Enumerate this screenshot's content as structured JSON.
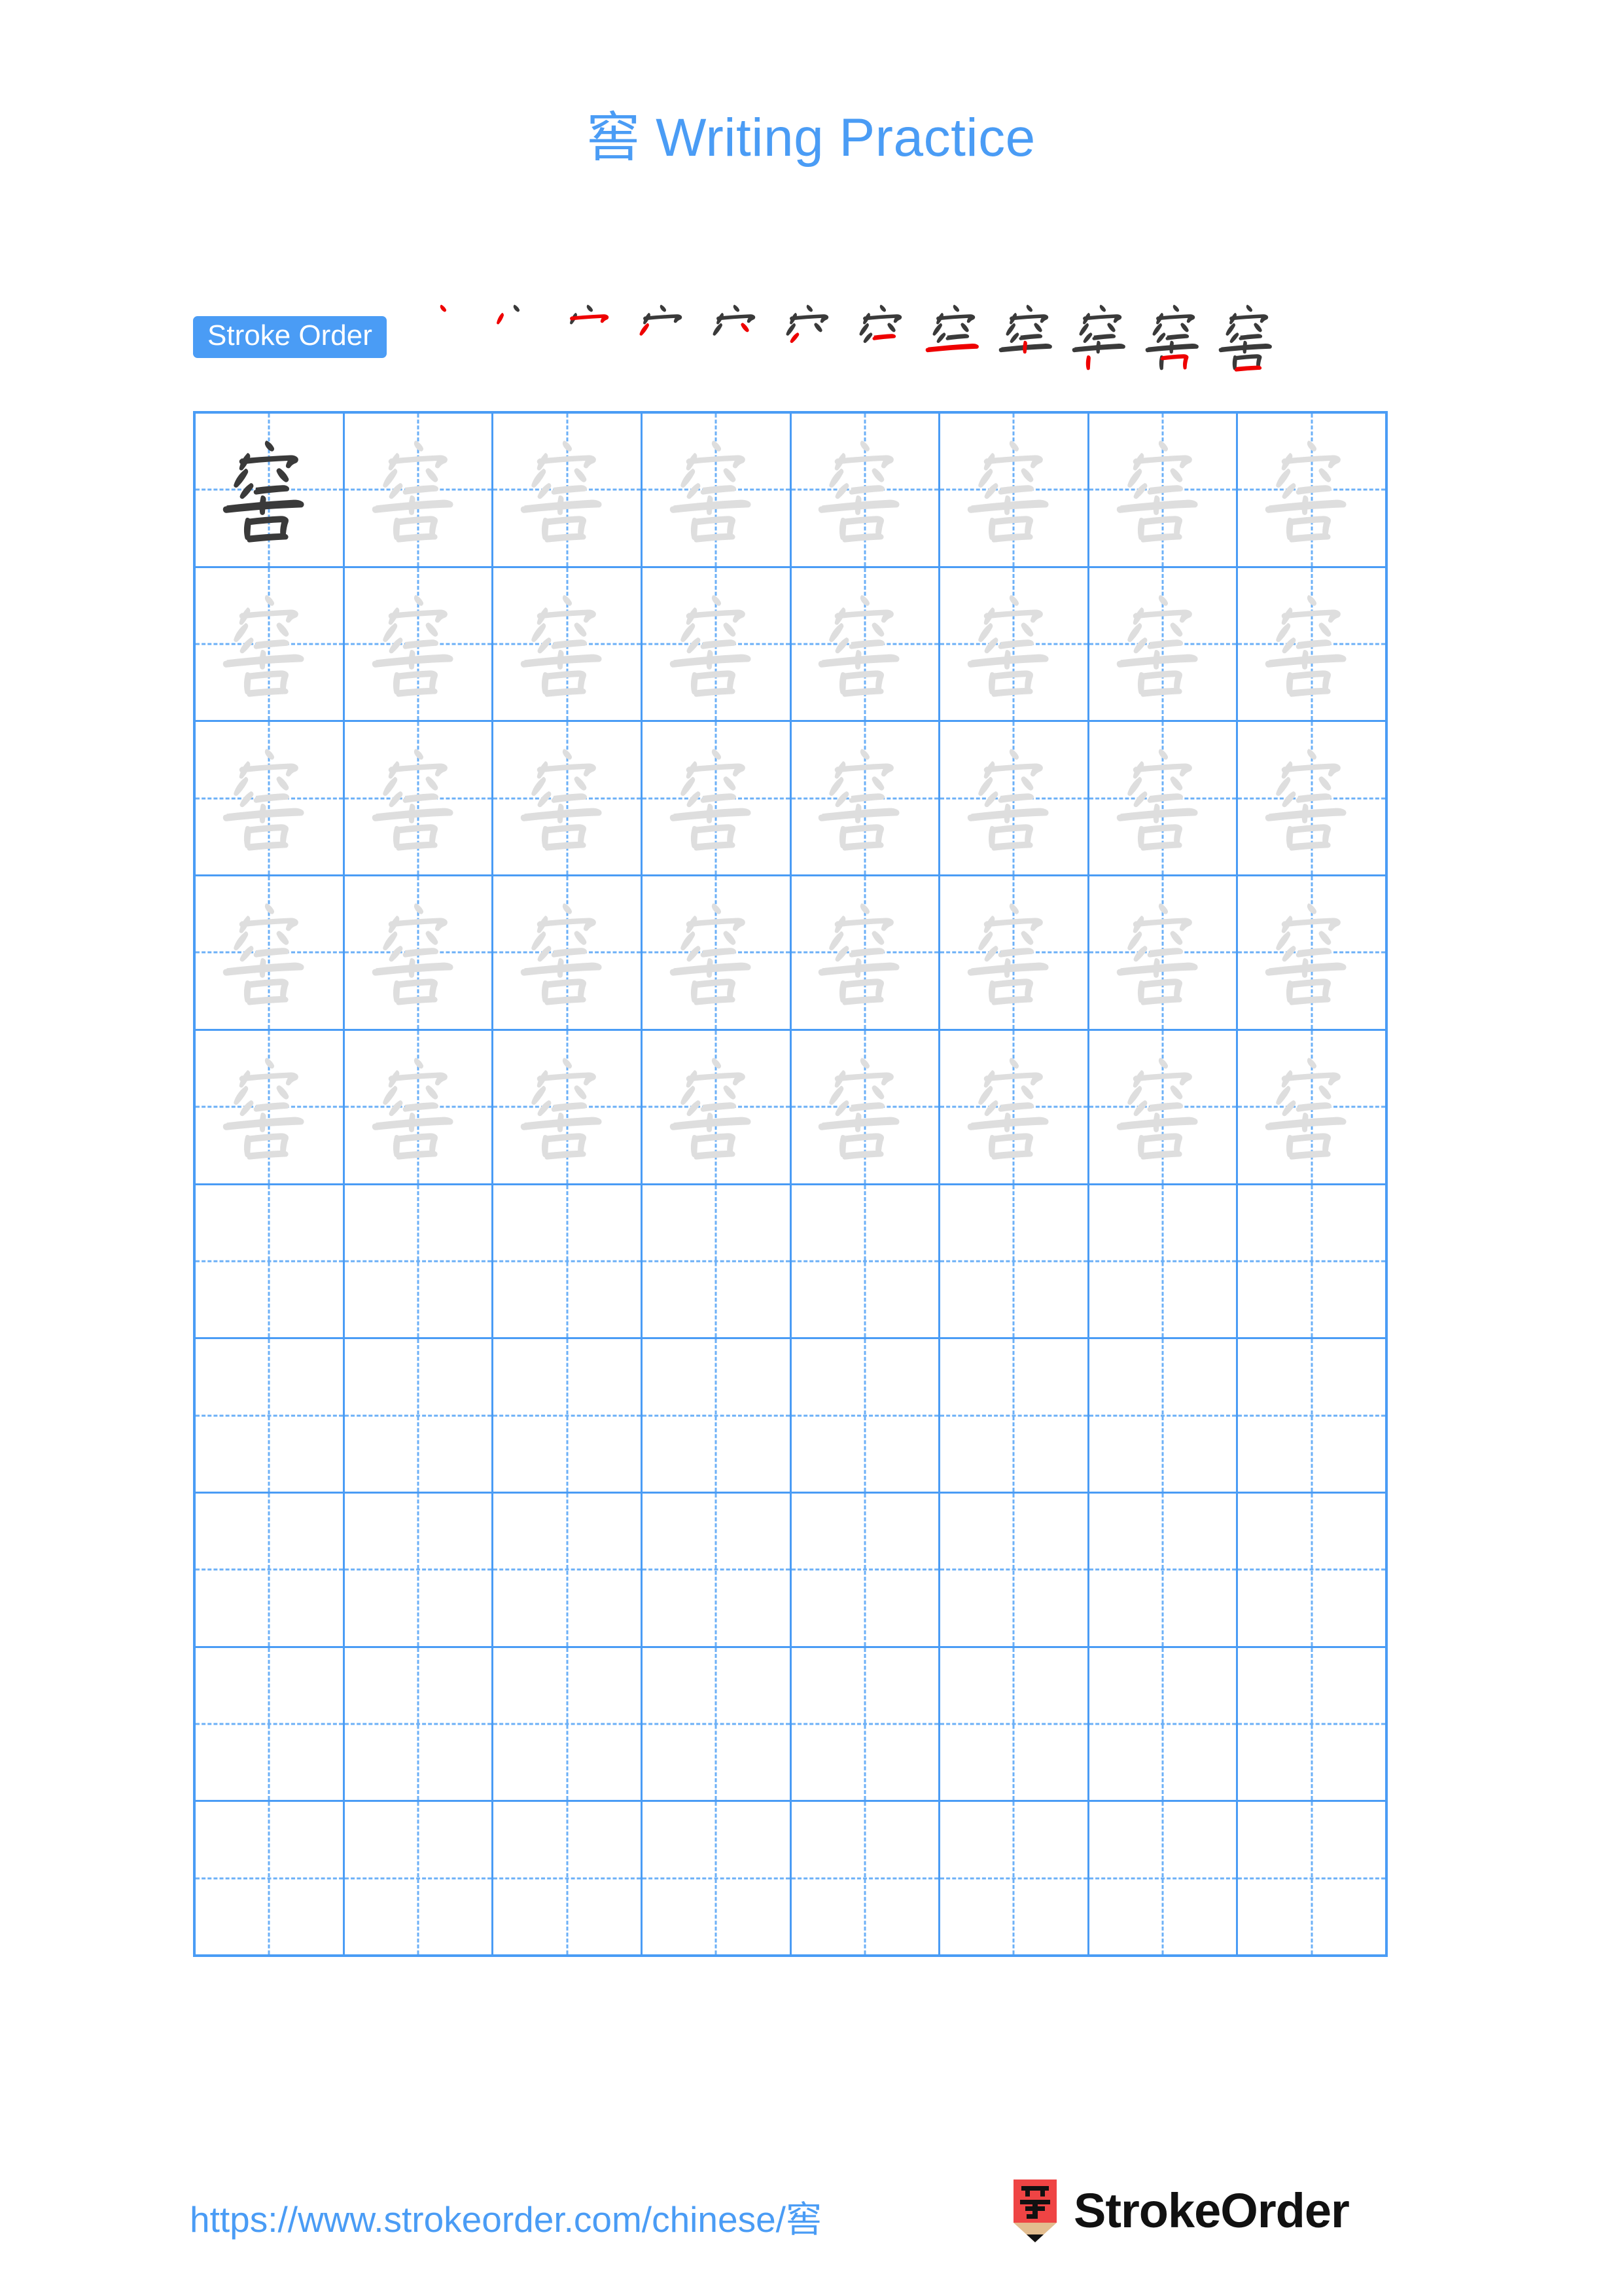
{
  "page": {
    "character": "窖",
    "title": "窖 Writing Practice",
    "background_color": "#ffffff"
  },
  "stroke_order": {
    "badge_label": "Stroke Order",
    "badge_bg_color": "#4a9cf5",
    "badge_text_color": "#ffffff",
    "total_strokes": 12,
    "new_stroke_color": "#ee0000",
    "existing_stroke_color": "#3a3a3a",
    "steps": [
      1,
      2,
      3,
      4,
      5,
      6,
      7,
      8,
      9,
      10,
      11,
      12
    ]
  },
  "grid": {
    "columns": 8,
    "rows": 10,
    "rows_with_characters": 5,
    "border_color": "#4a9cf5",
    "guide_color": "#6cb0f7",
    "model_char_color": "#3a3a3a",
    "trace_char_color": "#dedede",
    "cells": [
      [
        "model",
        "trace",
        "trace",
        "trace",
        "trace",
        "trace",
        "trace",
        "trace"
      ],
      [
        "trace",
        "trace",
        "trace",
        "trace",
        "trace",
        "trace",
        "trace",
        "trace"
      ],
      [
        "trace",
        "trace",
        "trace",
        "trace",
        "trace",
        "trace",
        "trace",
        "trace"
      ],
      [
        "trace",
        "trace",
        "trace",
        "trace",
        "trace",
        "trace",
        "trace",
        "trace"
      ],
      [
        "trace",
        "trace",
        "trace",
        "trace",
        "trace",
        "trace",
        "trace",
        "trace"
      ],
      [
        "empty",
        "empty",
        "empty",
        "empty",
        "empty",
        "empty",
        "empty",
        "empty"
      ],
      [
        "empty",
        "empty",
        "empty",
        "empty",
        "empty",
        "empty",
        "empty",
        "empty"
      ],
      [
        "empty",
        "empty",
        "empty",
        "empty",
        "empty",
        "empty",
        "empty",
        "empty"
      ],
      [
        "empty",
        "empty",
        "empty",
        "empty",
        "empty",
        "empty",
        "empty",
        "empty"
      ],
      [
        "empty",
        "empty",
        "empty",
        "empty",
        "empty",
        "empty",
        "empty",
        "empty"
      ]
    ]
  },
  "footer": {
    "url": "https://www.strokeorder.com/chinese/窖",
    "url_color": "#4a9cf5",
    "brand_name": "StrokeOrder",
    "brand_mark_character": "字",
    "brand_mark_color": "#ef4444"
  }
}
